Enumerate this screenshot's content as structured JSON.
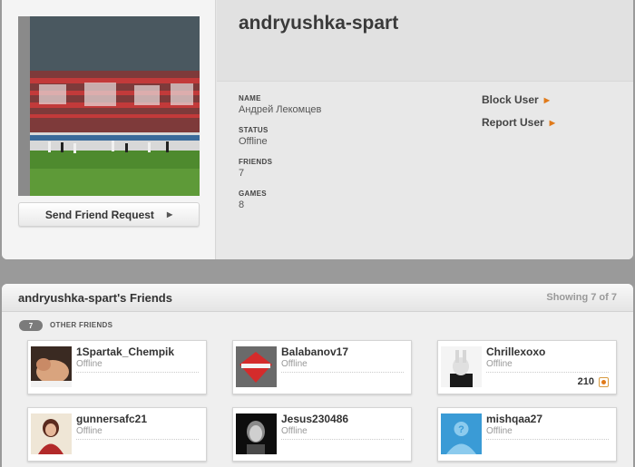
{
  "profile": {
    "username": "andryushka-spart",
    "send_request_label": "Send Friend Request",
    "name_label": "NAME",
    "name_value": "Андрей Лекомцев",
    "status_label": "STATUS",
    "status_value": "Offline",
    "friends_label": "FRIENDS",
    "friends_value": "7",
    "games_label": "GAMES",
    "games_value": "8",
    "block_label": "Block User",
    "report_label": "Report User"
  },
  "friends_section": {
    "title": "andryushka-spart's Friends",
    "showing": "Showing 7 of 7",
    "count": "7",
    "group_label": "OTHER FRIENDS",
    "friends": [
      {
        "name": "1Spartak_Chempik",
        "status": "Offline",
        "score": ""
      },
      {
        "name": "Balabanov17",
        "status": "Offline",
        "score": ""
      },
      {
        "name": "Chrillexoxo",
        "status": "Offline",
        "score": "210"
      },
      {
        "name": "gunnersafc21",
        "status": "Offline",
        "score": ""
      },
      {
        "name": "Jesus230486",
        "status": "Offline",
        "score": ""
      },
      {
        "name": "mishqaa27",
        "status": "Offline",
        "score": ""
      }
    ]
  },
  "colors": {
    "accent_arrow": "#e07a1a",
    "panel_bg": "#e6e6e6",
    "page_bg": "#9a9a9a"
  },
  "icons": {
    "link_arrow": "orange-triangle-right-icon",
    "button_arrow": "triangle-right-icon",
    "score_badge": "points-badge-icon"
  }
}
